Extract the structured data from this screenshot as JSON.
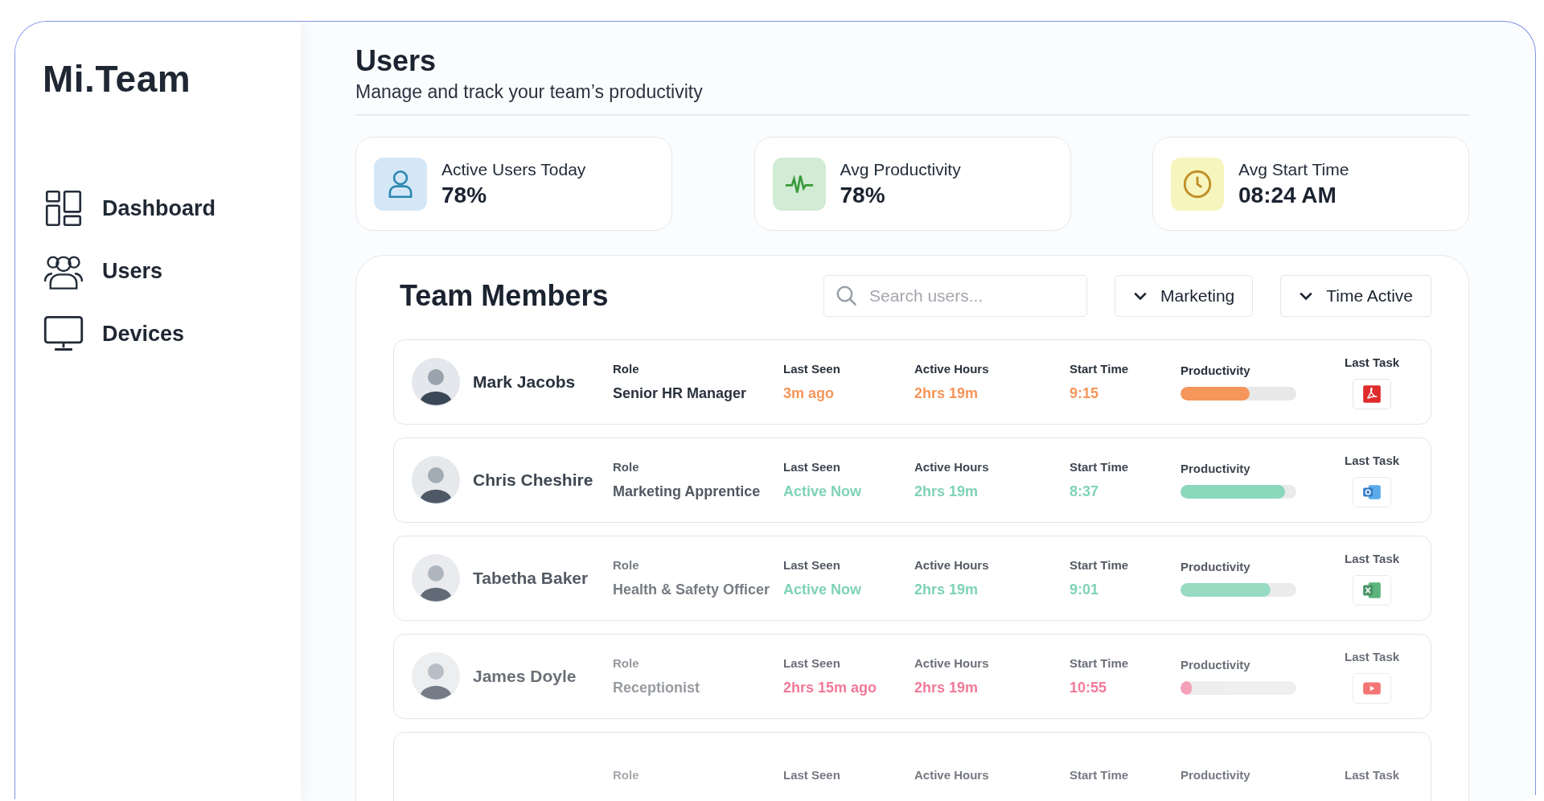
{
  "sidebar": {
    "logo": "Mi.Team",
    "items": [
      {
        "kind": "dashboard",
        "label": "Dashboard"
      },
      {
        "kind": "users",
        "label": "Users"
      },
      {
        "kind": "devices",
        "label": "Devices"
      }
    ]
  },
  "header": {
    "title": "Users",
    "subtitle": "Manage and track your team’s productivity"
  },
  "stats": [
    {
      "kind": "user",
      "label": "Active Users Today",
      "value": "78%"
    },
    {
      "kind": "pulse",
      "label": "Avg Productivity",
      "value": "78%"
    },
    {
      "kind": "clock",
      "label": "Avg Start Time",
      "value": "08:24 AM"
    }
  ],
  "team": {
    "title": "Team Members",
    "search": {
      "placeholder": "Search users..."
    },
    "filters": [
      "Marketing",
      "Time Active"
    ],
    "rows": [
      {
        "name": "Mark Jacobs",
        "role_label": "Role",
        "role": "Senior HR Manager",
        "last_seen_label": "Last Seen",
        "last_seen": "3m ago",
        "hours_label": "Active Hours",
        "hours": "2hrs 19m",
        "start_label": "Start Time",
        "start": "9:15",
        "productivity_label": "Productivity",
        "level": 0.6,
        "color": "#f5965a",
        "task_label": "Last Task",
        "task": {
          "kind": "pdf"
        }
      },
      {
        "name": "Chris Cheshire",
        "role_label": "Role",
        "role": "Marketing Apprentice",
        "last_seen_label": "Last Seen",
        "last_seen": "Active Now",
        "hours_label": "Active Hours",
        "hours": "2hrs 19m",
        "start_label": "Start Time",
        "start": "8:37",
        "productivity_label": "Productivity",
        "level": 0.9,
        "color": "#7fd3b5",
        "task_label": "Last Task",
        "task": {
          "kind": "mail"
        }
      },
      {
        "name": "Tabetha Baker",
        "role_label": "Role",
        "role": "Health & Safety Officer",
        "last_seen_label": "Last Seen",
        "last_seen": "Active Now",
        "hours_label": "Active Hours",
        "hours": "2hrs 19m",
        "start_label": "Start Time",
        "start": "9:01",
        "productivity_label": "Productivity",
        "level": 0.78,
        "color": "#7fd3b5",
        "task_label": "Last Task",
        "task": {
          "kind": "sheet"
        }
      },
      {
        "name": "James Doyle",
        "role_label": "Role",
        "role": "Receptionist",
        "last_seen_label": "Last Seen",
        "last_seen": "2hrs 15m ago",
        "hours_label": "Active Hours",
        "hours": "2hrs 19m",
        "start_label": "Start Time",
        "start": "10:55",
        "productivity_label": "Productivity",
        "level": 0.1,
        "color": "#f27a9a",
        "task_label": "Last Task",
        "task": {
          "kind": "video"
        }
      },
      {
        "role_label": "Role",
        "last_seen_label": "Last Seen",
        "hours_label": "Active Hours",
        "start_label": "Start Time",
        "productivity_label": "Productivity",
        "task_label": "Last Task"
      }
    ]
  }
}
